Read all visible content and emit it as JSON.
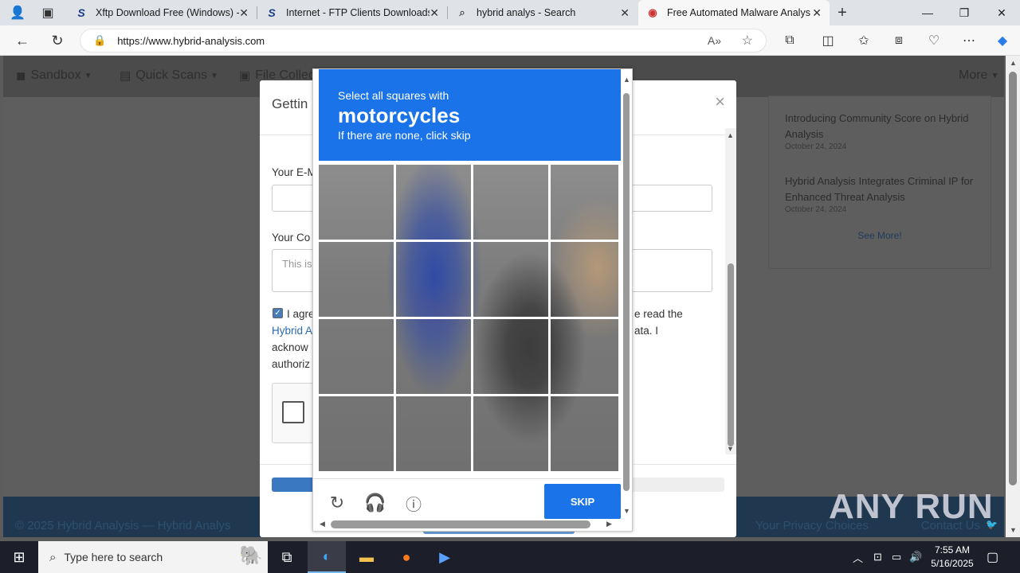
{
  "browser": {
    "tabs": [
      {
        "title": "Xftp Download Free (Windows) -",
        "icon": "S"
      },
      {
        "title": "Internet - FTP Clients Downloads",
        "icon": "S"
      },
      {
        "title": "hybrid analys - Search",
        "icon": "search-icon"
      },
      {
        "title": "Free Automated Malware Analysi",
        "icon": "hybrid-analysis-icon"
      }
    ],
    "url": "https://www.hybrid-analysis.com"
  },
  "site": {
    "nav": [
      {
        "label": "Sandbox"
      },
      {
        "label": "Quick Scans"
      },
      {
        "label": "File Collec"
      }
    ],
    "nav_more": "More",
    "news": [
      {
        "title": "Introducing Community Score on Hybrid Analysis",
        "date": "October 24, 2024"
      },
      {
        "title": "Hybrid Analysis Integrates Criminal IP for Enhanced Threat Analysis",
        "date": "October 24, 2024"
      }
    ],
    "see_more": "See More!",
    "footer_left": "© 2025 Hybrid Analysis — Hybrid Analys",
    "footer_right": "Your Privacy Choices",
    "footer_contact": "Contact Us"
  },
  "modal": {
    "title": "Gettin",
    "email_label": "Your E-M",
    "comment_label": "Your Co",
    "comment_placeholder": "This is",
    "agree_text_1": "I agre",
    "agree_text_1b": "e read the",
    "agree_link": "Hybrid A",
    "agree_text_2b": "ata. I",
    "agree_text_3": "acknow",
    "agree_text_4": "authoriz",
    "progress": 0.09
  },
  "captcha": {
    "instruction_top": "Select all squares with",
    "target": "motorcycles",
    "instruction_bottom": "If there are none, click skip",
    "skip_label": "SKIP",
    "icons": [
      "reload-icon",
      "audio-icon",
      "info-icon"
    ]
  },
  "watermark": "ANY RUN",
  "taskbar": {
    "search_placeholder": "Type here to search",
    "time": "7:55 AM",
    "date": "5/16/2025"
  }
}
